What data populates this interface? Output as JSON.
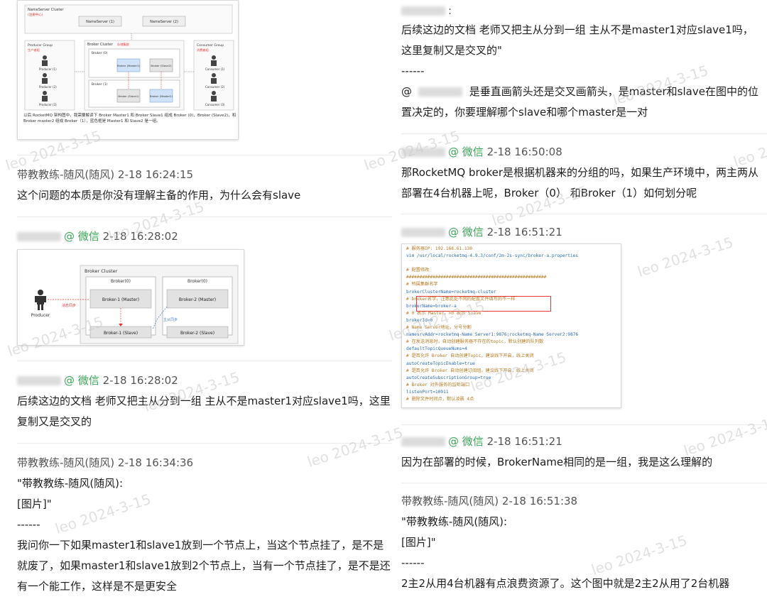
{
  "left": {
    "image1": {
      "nameserver_cluster": "NameServer Cluster",
      "nameserver_sub": "(注册中心)",
      "nameserver_nodes": [
        "NameServer (1)",
        "NameServer (2)"
      ],
      "producer_group": "Producer Group",
      "producer_group_sub": "生产者组",
      "producers": [
        "Producer (1)",
        "Producer (2)",
        "Producer (3)"
      ],
      "broker_cluster": "Broker Cluster",
      "broker_cluster_sub": "存储集群",
      "brokers": [
        "Broker (0)",
        "Broker (1)"
      ],
      "broker0_nodes": [
        "Broker (Master1)",
        "Broker (Slave2)"
      ],
      "broker1_nodes": [
        "Broker (Slave1)",
        "Broker (Master2)"
      ],
      "consumer_group": "Consumer Group",
      "consumer_group_sub": "消费者组",
      "consumers": [
        "Consumer (1)",
        "Consumer (2)",
        "Consumer (3)"
      ],
      "caption": "以后 RocketMQ 架构图中，我需要解读下 Broker Master1 和 Broker Slave1 组成 Broker (0)，Broker (Slave2)，和 Broker master2 组成 Broker（1），蓝色框是 Master1 和 Slave2 是一组。"
    },
    "msg1": {
      "sender": "带教教练-随风(随风)",
      "time": "2-18 16:24:15",
      "text": "这个问题的本质是你没有理解主备的作用，为什么会有slave"
    },
    "msg2": {
      "source": "@ 微信",
      "time": "2-18 16:28:02"
    },
    "image2": {
      "cluster": "Broker Cluster",
      "broker0": "Broker(0)",
      "broker1": "Broker(0)",
      "b1_master": "Broker-1 (Master)",
      "b2_master": "Broker-2 (Master)",
      "b1_slave": "Broker-1 (Slave)",
      "b2_slave": "Broker-2 (Slave)",
      "producer": "Producer",
      "send_label": "消息同步",
      "sync_label": "主从同步"
    },
    "msg3": {
      "source": "@ 微信",
      "time": "2-18 16:28:02",
      "text": "后续这边的文档 老师又把主从分到一组  主从不是master1对应slave1吗，这里复制又是交叉的"
    },
    "msg4": {
      "sender": "带教教练-随风(随风)",
      "time": "2-18 16:34:36",
      "quote1": "\"带教教练-随风(随风):",
      "quote2": "[图片]\"",
      "divider": "------",
      "text": "我问你一下如果master1和slave1放到一个节点上，当这个节点挂了，是不是就废了，如果master1和slave1放到2个节点上，当有一个节点挂了，是不是还有一个能工作，这样是不是更安全"
    }
  },
  "right": {
    "msg1": {
      "colon": ":",
      "quote": "后续这边的文档 老师又把主从分到一组  主从不是master1对应slave1吗，这里复制又是交叉的\"",
      "divider": "------",
      "at": "@",
      "text": "是垂直画箭头还是交叉画箭头，是master和slave在图中的位置决定的，你要理解哪个slave和哪个master是一对"
    },
    "msg2": {
      "source": "@ 微信",
      "time": "2-18 16:50:08",
      "text": "那RocketMQ broker是根据机器来的分组的吗，如果生产环境中，两主两从部署在4台机器上呢，Broker（0） 和Broker（1）如何划分呢"
    },
    "msg3": {
      "source": "@ 微信",
      "time": "2-18 16:51:21"
    },
    "code_lines": [
      "# 服务器IP: 192.168.61.130",
      "vim /usr/local/rocketmq-4.9.3/conf/2m-2s-sync/broker-a.properties",
      "",
      "# 配置修改",
      "#####################################################",
      "# 所属集群名字",
      "brokerClusterName=rocketmq-cluster",
      "# broker名字，注意此处不同的配置文件填写的不一样",
      "brokerName=broker-a",
      "# 0 表示 Master，>0 表示 Slave",
      "brokerId=0",
      "# Name Server地址，分号分割",
      "namesrvAddr=rocketmq-Name Server1:9876;rocketmq-Name Server2:9876",
      "# 在发送消息时，自动创建服务器不存在的topic，默认创建的队列数",
      "defaultTopicQueueNums=4",
      "# 是否允许 Broker 自动创建Topic，建议线下开启，线上关闭",
      "autoCreateTopicEnable=true",
      "# 是否允许 Broker 自动创建订阅组，建议线下开启，线上关闭",
      "autoCreateSubscriptionGroup=true",
      "# Broker 对外服务的监听端口",
      "listenPort=10911",
      "# 删除文件时间点，默认凌晨 4点"
    ],
    "msg4": {
      "source": "@ 微信",
      "time": "2-18 16:51:21",
      "text": "因为在部署的时候，BrokerName相同的是一组，我是这么理解的"
    },
    "msg5": {
      "sender": "带教教练-随风(随风)",
      "time": "2-18 16:51:38",
      "quote1": "\"带教教练-随风(随风):",
      "quote2": "[图片]\"",
      "divider": "------",
      "text": "2主2从用4台机器有点浪费资源了。这个图中就是2主2从用了2台机器"
    }
  },
  "watermark": "leo 2024-3-15",
  "colors": {
    "accent_green": "#3aa655",
    "highlight_red": "#e53935",
    "node_blue": "#cfe2f7"
  }
}
